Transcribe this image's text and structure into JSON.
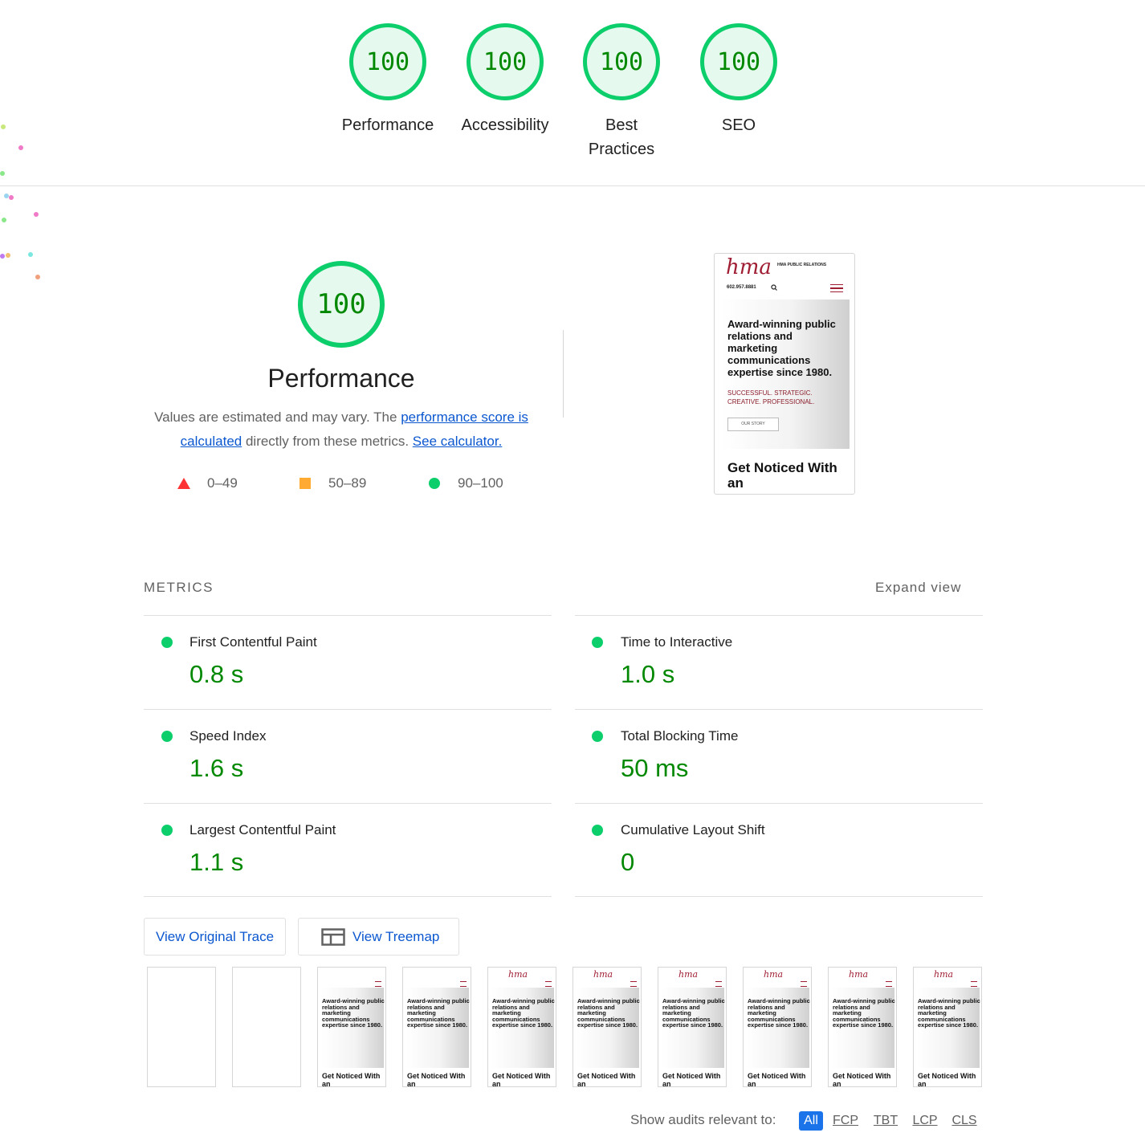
{
  "categories": [
    {
      "score": "100",
      "label": "Performance"
    },
    {
      "score": "100",
      "label": "Accessibility"
    },
    {
      "score": "100",
      "label": "Best Practices"
    },
    {
      "score": "100",
      "label": "SEO"
    }
  ],
  "performance": {
    "score": "100",
    "title": "Performance",
    "desc_pre": "Values are estimated and may vary. The ",
    "desc_link1": "performance score is calculated",
    "desc_mid": " directly from these metrics. ",
    "desc_link2": "See calculator.",
    "legend": [
      {
        "range": "0–49",
        "color": "#ff3333"
      },
      {
        "range": "50–89",
        "color": "#ffaa33"
      },
      {
        "range": "90–100",
        "color": "#0cce6b"
      }
    ]
  },
  "screenshot": {
    "logo": "hma",
    "brand": "HMA PUBLIC RELATIONS",
    "phone": "602.957.8881",
    "headline": "Award-winning public relations and marketing communications expertise since 1980.",
    "subline": "SUCCESSFUL. STRATEGIC. CREATIVE. PROFESSIONAL.",
    "button": "OUR STORY",
    "bottom": "Get Noticed With an"
  },
  "metrics": {
    "heading": "METRICS",
    "expand": "Expand view",
    "items": [
      {
        "name": "First Contentful Paint",
        "value": "0.8 s"
      },
      {
        "name": "Time to Interactive",
        "value": "1.0 s"
      },
      {
        "name": "Speed Index",
        "value": "1.6 s"
      },
      {
        "name": "Total Blocking Time",
        "value": "50 ms"
      },
      {
        "name": "Largest Contentful Paint",
        "value": "1.1 s"
      },
      {
        "name": "Cumulative Layout Shift",
        "value": "0"
      }
    ]
  },
  "actions": {
    "trace": "View Original Trace",
    "treemap": "View Treemap"
  },
  "filmstrip": {
    "headline": "Award-winning public relations and marketing communications expertise since 1980.",
    "bottom": "Get Noticed With an"
  },
  "filter": {
    "label": "Show audits relevant to:",
    "chips": [
      "All",
      "FCP",
      "TBT",
      "LCP",
      "CLS"
    ]
  },
  "colors": {
    "pass": "#0cce6b",
    "pass_text": "#008800",
    "link": "#0b57d0"
  }
}
